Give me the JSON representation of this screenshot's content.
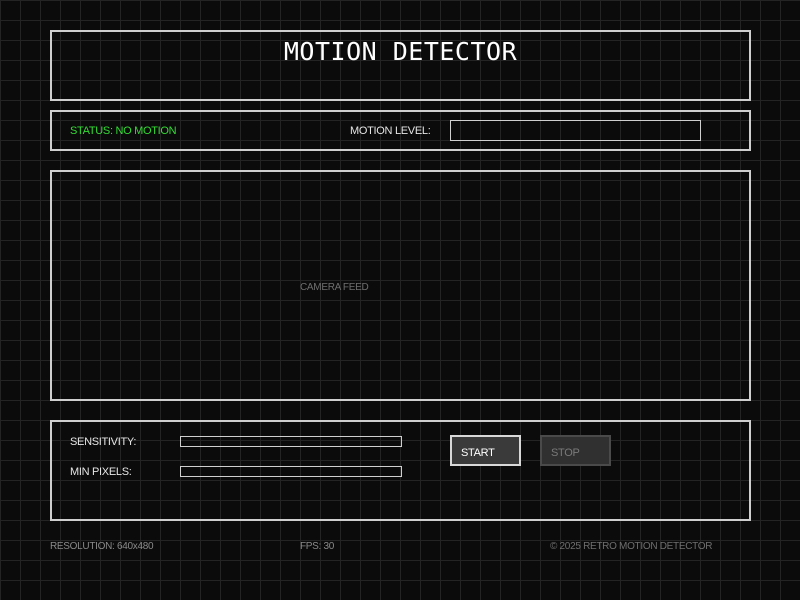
{
  "header": {
    "title": "MOTION DETECTOR"
  },
  "status_bar": {
    "status_text": "STATUS: NO MOTION",
    "status_color": "#33dd33",
    "motion_level_label": "MOTION LEVEL:",
    "motion_level_value": 0
  },
  "camera": {
    "placeholder": "CAMERA FEED"
  },
  "controls": {
    "sensitivity_label": "SENSITIVITY:",
    "min_pixels_label": "MIN PIXELS:",
    "start_label": "START",
    "stop_label": "STOP",
    "stop_enabled": false
  },
  "footer": {
    "resolution": "RESOLUTION: 640x480",
    "fps": "FPS: 30",
    "copyright": "© 2025 RETRO MOTION DETECTOR"
  },
  "colors": {
    "background": "#0b0b0b",
    "grid": "#242424",
    "border": "#cfcfcf",
    "status_ok": "#33dd33"
  }
}
